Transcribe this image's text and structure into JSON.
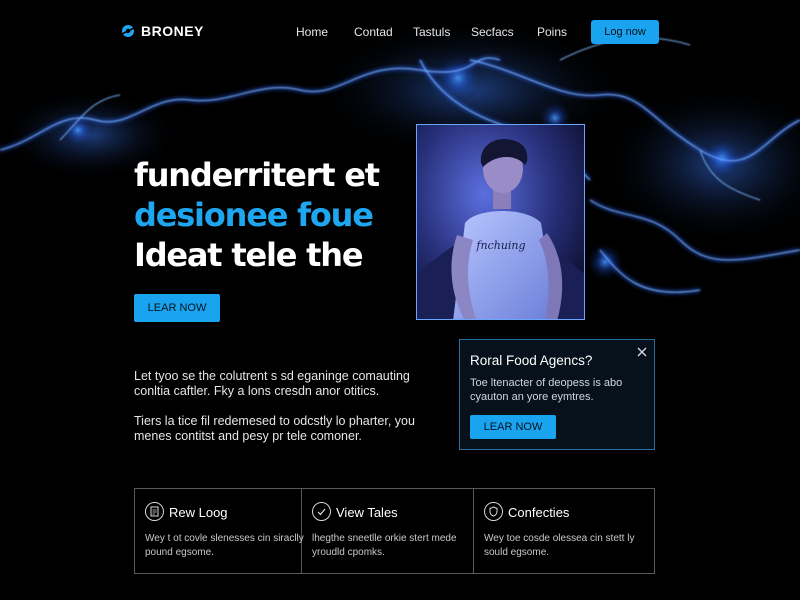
{
  "brand": {
    "name": "BRONEY",
    "logo_icon": "planet-ring-icon"
  },
  "nav": {
    "links": [
      "Home",
      "Contad",
      "Tastuls",
      "Secfacs",
      "Poins"
    ],
    "cta_label": "Log now"
  },
  "hero": {
    "line1": "funderritert et",
    "line2": "desionee foue",
    "line3": "Ideat tele the",
    "cta_label": "LEAR NOW",
    "photo_shirt_text": "fnchuing"
  },
  "body": {
    "paragraph1": "Let tyoo se the colutrent s sd eganinge comauting conltia caftler. Fky a lons cresdn anor otitics.",
    "paragraph2": "Tiers la tice fil redemesed to odcstly lo pharter, you menes contitst and pesy pr tele comoner."
  },
  "popup": {
    "title": "Roral Food Agencs?",
    "text": "Toe ltenacter of deopess is abo cyauton an yore eymtres.",
    "cta_label": "LEAR NOW",
    "close_icon": "close-icon"
  },
  "cards": [
    {
      "icon": "document-icon",
      "title": "Rew Loog",
      "text": "Wey t ot covle slenesses cin siraclly pound egsome."
    },
    {
      "icon": "check-circle-icon",
      "title": "View Tales",
      "text": "lhegthe sneetlle orkie stert mede yroudld cpomks."
    },
    {
      "icon": "shield-icon",
      "title": "Confecties",
      "text": "Wey toe cosde olessea cin stett ly sould egsome."
    }
  ],
  "colors": {
    "background": "#000000",
    "accent": "#1ea6f0",
    "button": "#1aa3ee",
    "glow": "#2f6bff",
    "card_border": "#555a60",
    "popup_border": "#2a6fa0"
  }
}
